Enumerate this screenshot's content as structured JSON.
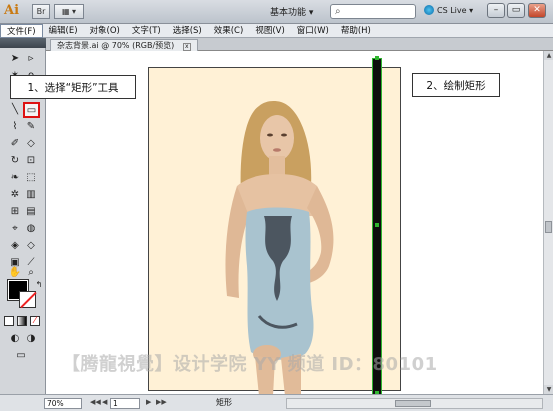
{
  "app": {
    "logo": "Ai",
    "workspace": "基本功能 ▾",
    "cs_live": "CS Live ▾",
    "bridge": "Br"
  },
  "window_buttons": {
    "minimize": "–",
    "restore": "▭",
    "close": "✕"
  },
  "menu": [
    {
      "label": "文件(F)",
      "selected": true
    },
    {
      "label": "编辑(E)"
    },
    {
      "label": "对象(O)"
    },
    {
      "label": "文字(T)"
    },
    {
      "label": "选择(S)"
    },
    {
      "label": "效果(C)"
    },
    {
      "label": "视图(V)"
    },
    {
      "label": "窗口(W)"
    },
    {
      "label": "帮助(H)"
    }
  ],
  "document": {
    "tab_label": "杂志背景.ai @ 70% (RGB/预览)",
    "close": "x"
  },
  "callouts": {
    "step1": "1、选择“矩形”工具",
    "step2": "2、绘制矩形"
  },
  "watermark": "【腾龍視覺】设计学院 YY 频道 ID：80101",
  "status": {
    "zoom": "70%",
    "page": "1",
    "tool": "矩形",
    "nav_first": "◀◀",
    "nav_prev": "◀",
    "nav_next": "▶",
    "nav_last": "▶▶"
  },
  "colors": {
    "fill": "#000000",
    "stroke": "none",
    "artboard_bg": "#fff1d6",
    "selection": "#2fb52f",
    "highlight": "#dd1111"
  },
  "tools": [
    "selection-icon",
    "direct-selection-icon",
    "magic-wand-icon",
    "lasso-icon",
    "pen-icon",
    "type-icon",
    "line-icon",
    "rectangle-icon",
    "paintbrush-icon",
    "pencil-icon",
    "blob-brush-icon",
    "eraser-icon",
    "rotate-icon",
    "scale-icon",
    "warp-icon",
    "free-transform-icon",
    "symbol-sprayer-icon",
    "column-graph-icon",
    "mesh-icon",
    "gradient-icon",
    "eyedropper-icon",
    "blend-icon",
    "live-paint-icon",
    "live-paint-selection-icon",
    "artboard-icon",
    "slice-icon",
    "hand-icon",
    "zoom-icon"
  ]
}
